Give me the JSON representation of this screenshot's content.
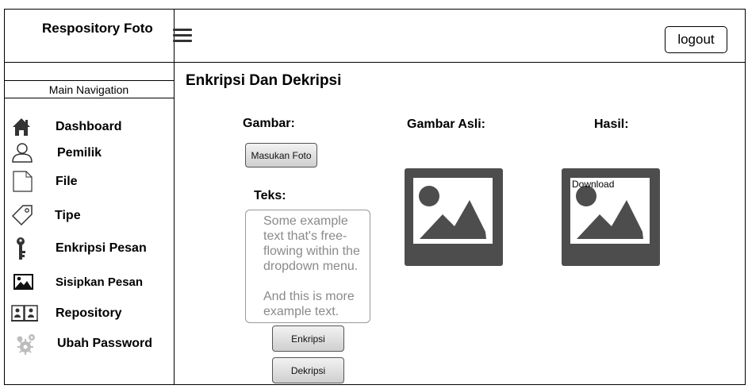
{
  "header": {
    "app_title": "Respository Foto",
    "menu_icon": "hamburger-icon",
    "logout_label": "logout"
  },
  "sidebar": {
    "title": "Main Navigation",
    "items": [
      {
        "label": "Dashboard",
        "icon": "home-icon"
      },
      {
        "label": "Pemilik",
        "icon": "user-icon"
      },
      {
        "label": "File",
        "icon": "file-icon"
      },
      {
        "label": "Tipe",
        "icon": "tag-icon"
      },
      {
        "label": "Enkripsi Pesan",
        "icon": "key-icon"
      },
      {
        "label": "Sisipkan Pesan",
        "icon": "image-icon"
      },
      {
        "label": "Repository",
        "icon": "contacts-book-icon"
      },
      {
        "label": "Ubah Password",
        "icon": "gears-icon"
      }
    ]
  },
  "main": {
    "page_title": "Enkripsi Dan Dekripsi",
    "gambar_label": "Gambar:",
    "upload_button": "Masukan Foto",
    "teks_label": "Teks:",
    "text_paragraph_1": "Some example text that's free-flowing within the dropdown menu.",
    "text_paragraph_2": "And this is more example text.",
    "encrypt_button": "Enkripsi",
    "decrypt_button": "Dekripsi",
    "original_label": "Gambar Asli:",
    "result_label": "Hasil:",
    "download_link": "Download"
  },
  "colors": {
    "placeholder_dark": "#4d4d4d",
    "button_border": "#555555",
    "text_gray": "#8a8a8a"
  }
}
